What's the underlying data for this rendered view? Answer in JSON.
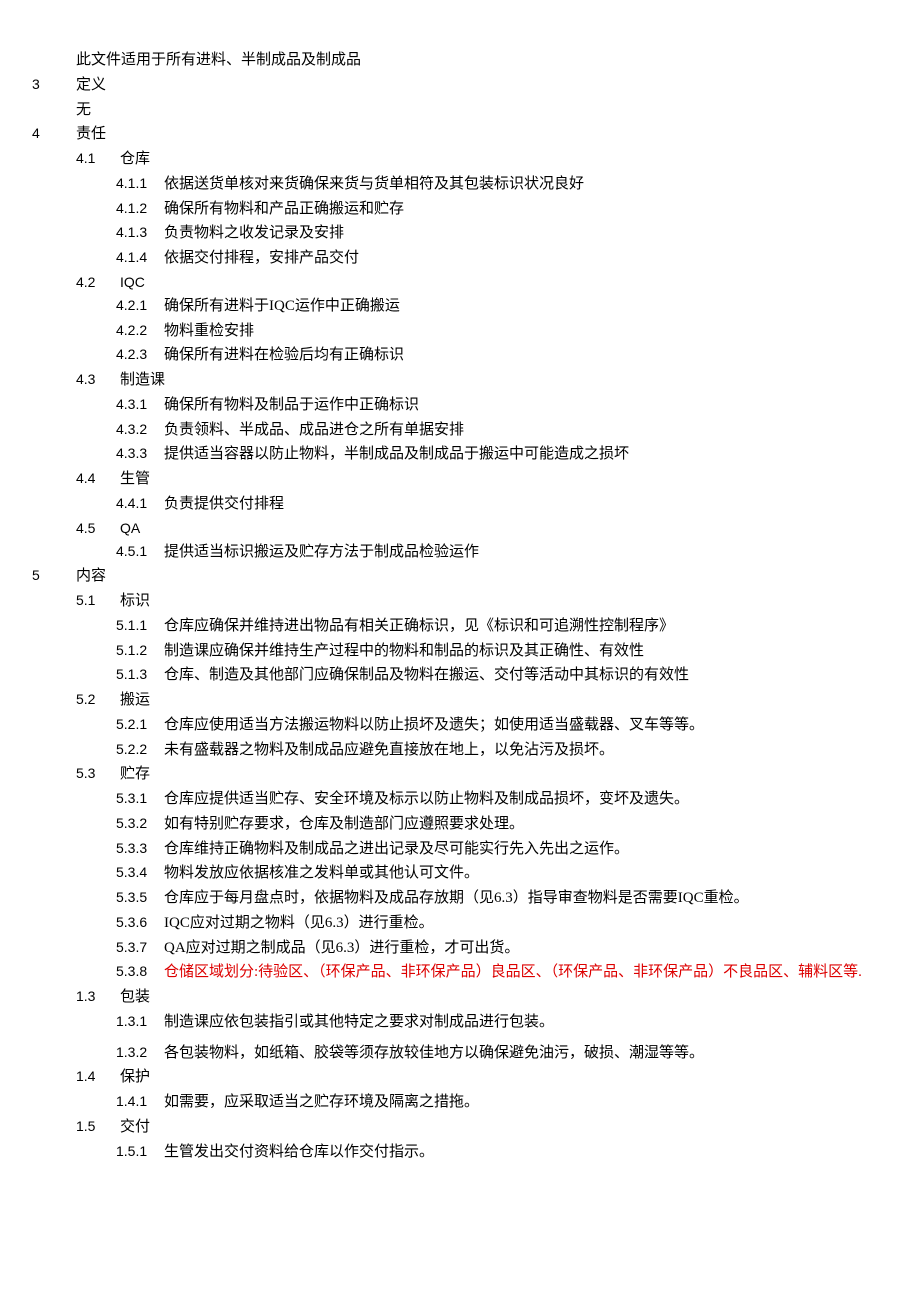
{
  "intro": "此文件适用于所有进料、半制成品及制成品",
  "s3": {
    "num": "3",
    "title": "定义",
    "body": "无"
  },
  "s4": {
    "num": "4",
    "title": "责任",
    "p41": {
      "num": "4.1",
      "title": "仓库",
      "i1": {
        "num": "4.1.1",
        "txt": "依据送货单核对来货确保来货与货单相符及其包装标识状况良好"
      },
      "i2": {
        "num": "4.1.2",
        "txt": "确保所有物料和产品正确搬运和贮存"
      },
      "i3": {
        "num": "4.1.3",
        "txt": "负责物料之收发记录及安排"
      },
      "i4": {
        "num": "4.1.4",
        "txt": "依据交付排程，安排产品交付"
      }
    },
    "p42": {
      "num": "4.2",
      "title": "IQC",
      "i1": {
        "num": "4.2.1",
        "txt": "确保所有进料于IQC运作中正确搬运"
      },
      "i2": {
        "num": "4.2.2",
        "txt": "物料重检安排"
      },
      "i3": {
        "num": "4.2.3",
        "txt": "确保所有进料在检验后均有正确标识"
      }
    },
    "p43": {
      "num": "4.3",
      "title": "制造课",
      "i1": {
        "num": "4.3.1",
        "txt": "确保所有物料及制品于运作中正确标识"
      },
      "i2": {
        "num": "4.3.2",
        "txt": "负责领料、半成品、成品进仓之所有单据安排"
      },
      "i3": {
        "num": "4.3.3",
        "txt": "提供适当容器以防止物料，半制成品及制成品于搬运中可能造成之损坏"
      }
    },
    "p44": {
      "num": "4.4",
      "title": "生管",
      "i1": {
        "num": "4.4.1",
        "txt": "负责提供交付排程"
      }
    },
    "p45": {
      "num": "4.5",
      "title": "QA",
      "i1": {
        "num": "4.5.1",
        "txt": "提供适当标识搬运及贮存方法于制成品检验运作"
      }
    }
  },
  "s5": {
    "num": "5",
    "title": "内容",
    "p51": {
      "num": "5.1",
      "title": "标识",
      "i1": {
        "num": "5.1.1",
        "txt": "仓库应确保并维持进出物品有相关正确标识，见《标识和可追溯性控制程序》"
      },
      "i2": {
        "num": "5.1.2",
        "txt": "制造课应确保并维持生产过程中的物料和制品的标识及其正确性、有效性"
      },
      "i3": {
        "num": "5.1.3",
        "txt": "仓库、制造及其他部门应确保制品及物料在搬运、交付等活动中其标识的有效性"
      }
    },
    "p52": {
      "num": "5.2",
      "title": "搬运",
      "i1": {
        "num": "5.2.1",
        "txt": "仓库应使用适当方法搬运物料以防止损坏及遗失；如使用适当盛载器、叉车等等。"
      },
      "i2": {
        "num": "5.2.2",
        "txt": "未有盛载器之物料及制成品应避免直接放在地上，以免沾污及损坏。"
      }
    },
    "p53": {
      "num": "5.3",
      "title": "贮存",
      "i1": {
        "num": "5.3.1",
        "txt": "仓库应提供适当贮存、安全环境及标示以防止物料及制成品损坏，变坏及遗失。"
      },
      "i2": {
        "num": "5.3.2",
        "txt": "如有特别贮存要求，仓库及制造部门应遵照要求处理。"
      },
      "i3": {
        "num": "5.3.3",
        "txt": "仓库维持正确物料及制成品之进出记录及尽可能实行先入先出之运作。"
      },
      "i4": {
        "num": "5.3.4",
        "txt": "物料发放应依据核准之发料单或其他认可文件。"
      },
      "i5": {
        "num": "5.3.5",
        "txt": "仓库应于每月盘点时，依据物料及成品存放期（见6.3）指导审查物料是否需要IQC重检。"
      },
      "i6": {
        "num": "5.3.6",
        "txt": "IQC应对过期之物料（见6.3）进行重检。"
      },
      "i7": {
        "num": "5.3.7",
        "txt": "QA应对过期之制成品（见6.3）进行重检，才可出货。"
      },
      "i8": {
        "num": "5.3.8",
        "txt": "仓储区域划分:待验区、（环保产品、非环保产品）良品区、（环保产品、非环保产品）不良品区、辅料区等."
      }
    },
    "p13": {
      "num": "1.3",
      "title": "包装",
      "i1": {
        "num": "1.3.1",
        "txt": "制造课应依包装指引或其他特定之要求对制成品进行包装。"
      },
      "i2": {
        "num": "1.3.2",
        "txt": "各包装物料，如纸箱、胶袋等须存放较佳地方以确保避免油污，破损、潮湿等等。"
      }
    },
    "p14": {
      "num": "1.4",
      "title": "保护",
      "i1": {
        "num": "1.4.1",
        "txt": "如需要，应采取适当之贮存环境及隔离之措拖。"
      }
    },
    "p15": {
      "num": "1.5",
      "title": "交付",
      "i1": {
        "num": "1.5.1",
        "txt": "生管发出交付资料给仓库以作交付指示。"
      }
    }
  }
}
